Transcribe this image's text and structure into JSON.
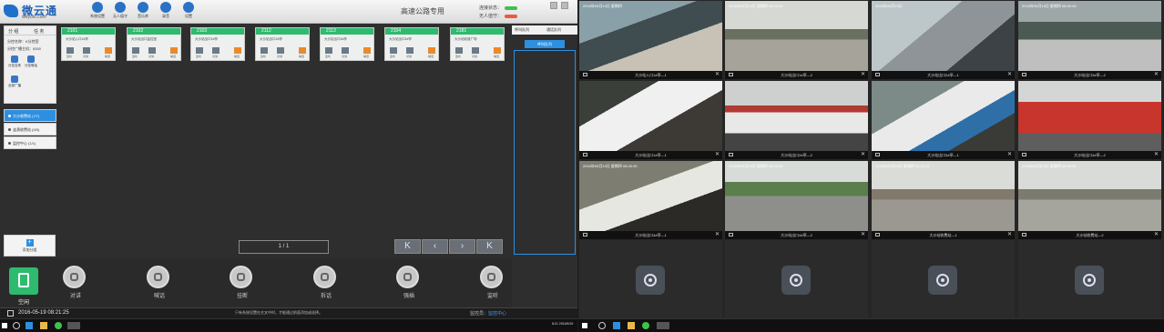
{
  "app": {
    "logo_text": "微云通",
    "logo_sub": "weyoto.com",
    "page_title": "高速公路专用",
    "status_line1": "连接状态：",
    "status_line2": "无人值守："
  },
  "toolbar": [
    {
      "label": "系统设置",
      "icon": "settings-icon"
    },
    {
      "label": "无人值守",
      "icon": "unattended-icon"
    },
    {
      "label": "音乐库",
      "icon": "music-icon"
    },
    {
      "label": "录音",
      "icon": "record-icon"
    },
    {
      "label": "设置",
      "icon": "user-icon"
    }
  ],
  "sidebar": {
    "tab1": "分 组",
    "tab2": "任 务",
    "line1": "分控名称：K分控室",
    "line2": "分控广播主机：0000",
    "icons": [
      {
        "label": "分控名称"
      },
      {
        "label": "分控喊话"
      },
      {
        "label": "全部广播"
      }
    ],
    "groups": [
      {
        "label": "大沙收费站 (7/7)",
        "active": true
      },
      {
        "label": "涟漪收费站 (0/0)",
        "active": false
      },
      {
        "label": "监控中心 (1/1)",
        "active": false
      }
    ],
    "add_label": "添加分组"
  },
  "cards": [
    {
      "id": "2101",
      "name": "大沙站入口1#亭"
    },
    {
      "id": "2102",
      "name": "大沙站出口监控室"
    },
    {
      "id": "2103",
      "name": "大沙站出口1#亭"
    },
    {
      "id": "2112",
      "name": "大沙站出口2#亭"
    },
    {
      "id": "2113",
      "name": "大沙站出口3#亭"
    },
    {
      "id": "2104",
      "name": "大沙站出口4#亭"
    },
    {
      "id": "2181",
      "name": "大沙站收费广场"
    }
  ],
  "card_buttons": [
    "监听",
    "对讲",
    "喊话"
  ],
  "pager": {
    "text": "1 / 1",
    "first": "K",
    "prev": "‹",
    "next": "›",
    "last": "K"
  },
  "right_panel": {
    "tab1": "呼叫队列",
    "tab2": "通话队列",
    "button": "呼叫队列"
  },
  "bottom": {
    "phone_label": "空闲",
    "buttons": [
      {
        "label": "对讲",
        "icon": "intercom-icon"
      },
      {
        "label": "喊话",
        "icon": "megaphone-icon"
      },
      {
        "label": "挂断",
        "icon": "hangup-icon"
      },
      {
        "label": "拆话",
        "icon": "split-call-icon"
      },
      {
        "label": "强插",
        "icon": "barge-in-icon"
      },
      {
        "label": "监听",
        "icon": "headset-icon"
      }
    ]
  },
  "statusbar": {
    "datetime": "2016-05-19  08:21:25",
    "message": "只有系统设置在交叉中时，才能通过前面添加或选择。",
    "monitor_label": "监控员：",
    "monitor_value": "监控中心"
  },
  "taskbar_left_clock": "8:21\n2016/5/19",
  "cameras": [
    {
      "caption": "大沙站入口1#亭—1",
      "timestamp": "2016年05月19日 星期四",
      "scene": "sc1"
    },
    {
      "caption": "大沙站出口1#亭—2",
      "timestamp": "2016年05月19日 星期四 08:20:30",
      "scene": "sc2"
    },
    {
      "caption": "大沙站出口2#亭—1",
      "timestamp": "2016年05月19日",
      "scene": "sc3"
    },
    {
      "caption": "大沙站出口3#亭—2",
      "timestamp": "2016年05月19日 星期四 08:20:30",
      "scene": "sc4"
    },
    {
      "caption": "大沙站出口1#亭—1",
      "timestamp": "",
      "scene": "sc5"
    },
    {
      "caption": "大沙站出口2#亭—2",
      "timestamp": "",
      "scene": "sc6"
    },
    {
      "caption": "大沙站出口3#亭—1",
      "timestamp": "",
      "scene": "sc7"
    },
    {
      "caption": "大沙站出口4#亭—2",
      "timestamp": "",
      "scene": "sc8"
    },
    {
      "caption": "大沙站出口4#亭—1",
      "timestamp": "2016年05月19日 星期四 08:20:30",
      "scene": "sc9"
    },
    {
      "caption": "大沙站出口4#亭—2",
      "timestamp": "2016年05月19日 星期四 08:20:30",
      "scene": "sc10"
    },
    {
      "caption": "大沙站收费站—1",
      "timestamp": "2016年05月19日 星期四 08:20:34",
      "scene": "sc11"
    },
    {
      "caption": "大沙站收费站—2",
      "timestamp": "2016年05月19日 星期四 08:20:34",
      "scene": "sc12"
    }
  ]
}
